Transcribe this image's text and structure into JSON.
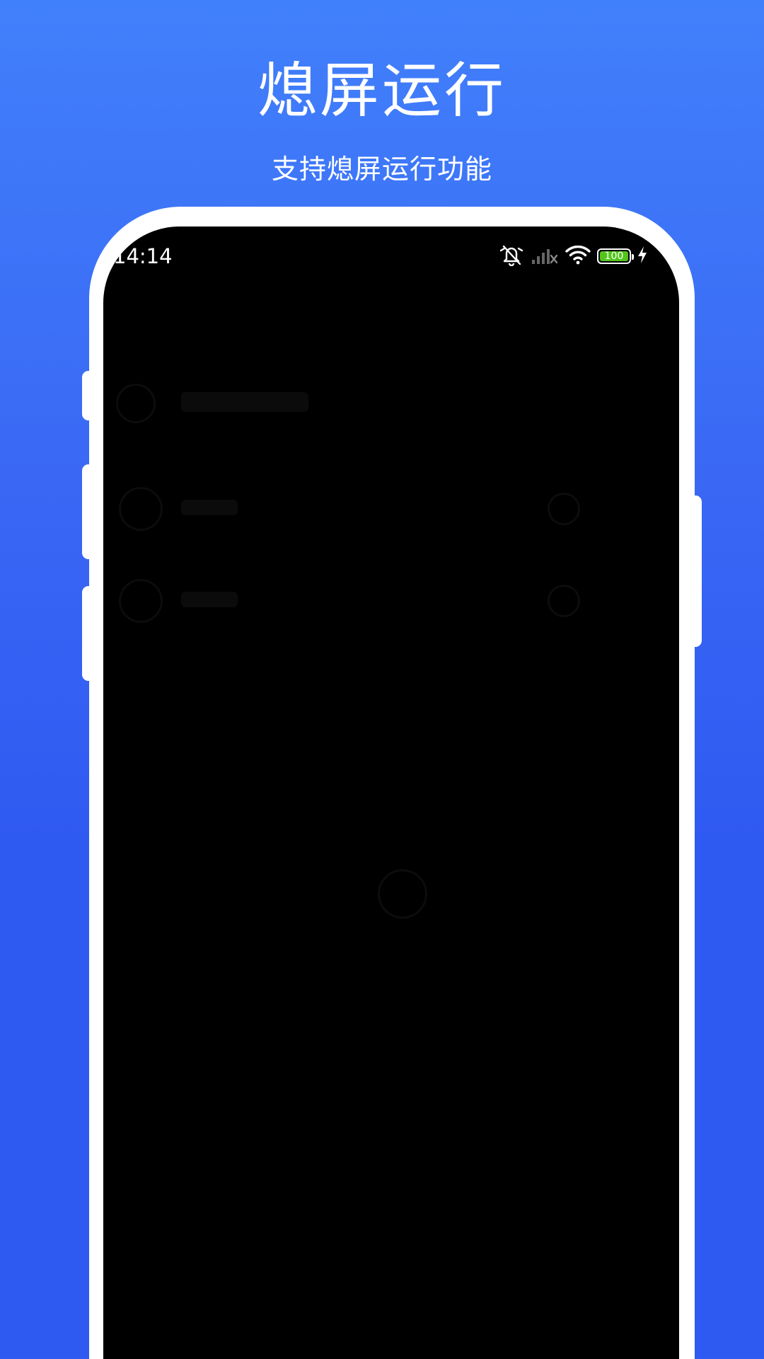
{
  "promo": {
    "title": "熄屏运行",
    "subtitle": "支持熄屏运行功能"
  },
  "status_bar": {
    "time": "14:14",
    "battery_level": "100",
    "icons": [
      "mute-icon",
      "signal-icon",
      "wifi-icon",
      "battery-icon",
      "charging-icon"
    ]
  },
  "colors": {
    "background_top": "#4180fb",
    "background_bottom": "#2e5af2",
    "battery_fill": "#52c41a",
    "screen": "#000000"
  }
}
